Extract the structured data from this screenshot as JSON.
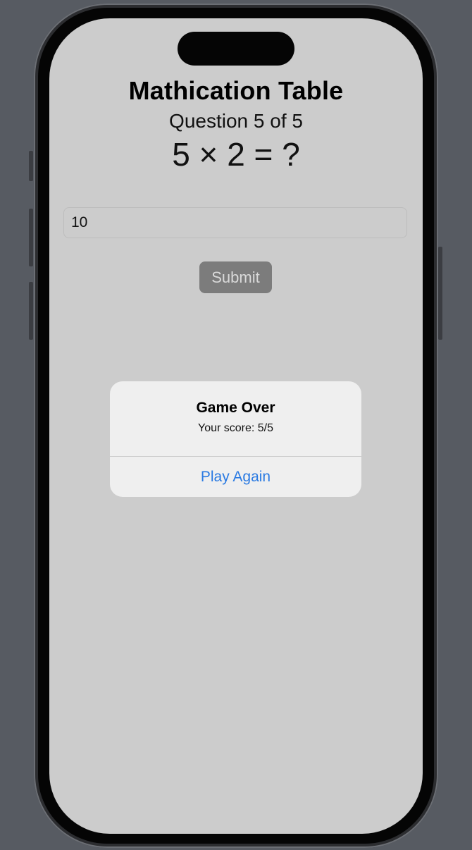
{
  "app": {
    "title": "Mathication Table",
    "progress_text": "Question 5 of 5",
    "question_text": "5 × 2 = ?"
  },
  "answer_input": {
    "value": "10",
    "placeholder": ""
  },
  "submit_button": {
    "label": "Submit"
  },
  "alert": {
    "title": "Game Over",
    "message": "Your score: 5/5",
    "action_label": "Play Again"
  },
  "colors": {
    "screen_background": "#cccccc",
    "accent": "#2a7ae2",
    "button_disabled": "#7c7c7c"
  }
}
